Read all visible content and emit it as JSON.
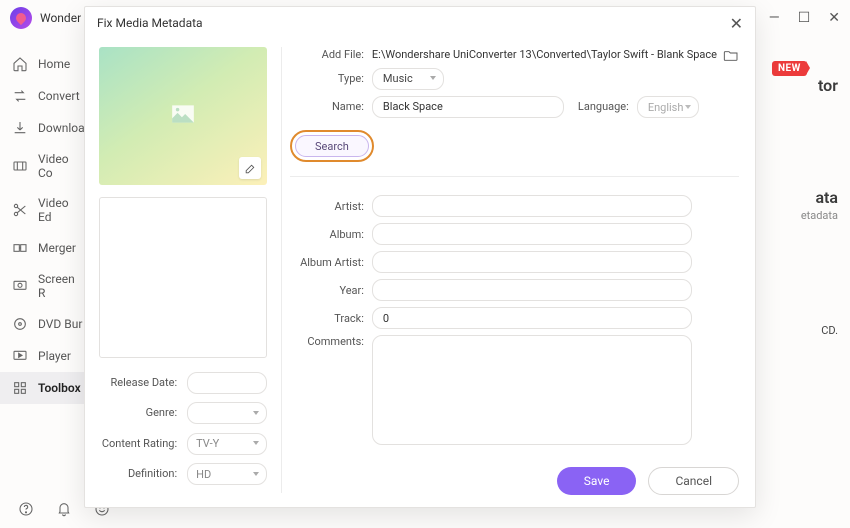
{
  "app": {
    "title": "Wonder"
  },
  "window_controls": {
    "minimize": "—",
    "maximize": "☐",
    "close": "✕"
  },
  "sidebar": {
    "items": [
      {
        "label": "Home"
      },
      {
        "label": "Convert"
      },
      {
        "label": "Downloa"
      },
      {
        "label": "Video Co"
      },
      {
        "label": "Video Ed"
      },
      {
        "label": "Merger"
      },
      {
        "label": "Screen R"
      },
      {
        "label": "DVD Bur"
      },
      {
        "label": "Player"
      },
      {
        "label": "Toolbox"
      }
    ]
  },
  "background": {
    "new_badge": "NEW",
    "peek_title_1": "tor",
    "peek_title_2": "ata",
    "peek_sub": "etadata",
    "peek_line": "CD."
  },
  "dialog": {
    "title": "Fix Media Metadata",
    "close": "✕",
    "add_file_label": "Add File:",
    "add_file_path": "E:\\Wondershare UniConverter 13\\Converted\\Taylor Swift - Blank Space",
    "type_label": "Type:",
    "type_value": "Music",
    "name_label": "Name:",
    "name_value": "Black Space",
    "language_label": "Language:",
    "language_value": "English",
    "search_label": "Search",
    "fields": {
      "artist_label": "Artist:",
      "artist_value": "",
      "album_label": "Album:",
      "album_value": "",
      "album_artist_label": "Album Artist:",
      "album_artist_value": "",
      "year_label": "Year:",
      "year_value": "",
      "track_label": "Track:",
      "track_value": "0",
      "comments_label": "Comments:",
      "comments_value": ""
    },
    "left_fields": {
      "release_date_label": "Release Date:",
      "release_date_value": "",
      "genre_label": "Genre:",
      "genre_value": "",
      "content_rating_label": "Content Rating:",
      "content_rating_value": "TV-Y",
      "definition_label": "Definition:",
      "definition_value": "HD"
    },
    "footer": {
      "save": "Save",
      "cancel": "Cancel"
    }
  }
}
